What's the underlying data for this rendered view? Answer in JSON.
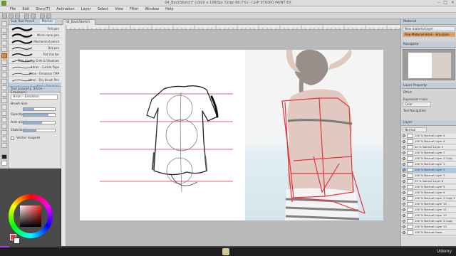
{
  "window": {
    "title": "04_BackSketch* (1920 x 1080px 72dpi 66.7%) - CLIP STUDIO PAINT EX"
  },
  "menu": [
    "File",
    "Edit",
    "Story(T)",
    "Animation",
    "Layer",
    "Select",
    "View",
    "Filter",
    "Window",
    "Help"
  ],
  "subtool_panel": {
    "tab": "Sub Tool Pencil",
    "tab2": "Marker",
    "brushes": [
      "Felt pen",
      "Micro-nano pen",
      "Mechanical pencil",
      "Dot pen",
      "Flat marker",
      "Thin Analog Grits & Shadows",
      "Hiron - Cuticle Tape",
      "Hiron - Emulsion TMP",
      "Hiron - Dry Brush Pen",
      "Hiron - Emulsion"
    ],
    "selected_index": 9
  },
  "tool_detail": {
    "tab": "Tool property [Hiron - Emulsion]",
    "selected_brush": "Hiron - Emulsion",
    "props": [
      {
        "label": "Brush Size",
        "value": 0.35
      },
      {
        "label": "Opacity",
        "value": 0.8
      },
      {
        "label": "Anti-aliasing",
        "value": 0.6
      },
      {
        "label": "Stabilization",
        "value": 0.4
      }
    ],
    "vector_label": "Vector magnet"
  },
  "document_tab": "04_BackSketch",
  "right_panel": {
    "header": "Material",
    "materials": [
      "New material layer",
      "Fine Material Hiron - Emulsion"
    ],
    "navigator_tab": "Navigator",
    "layer_property": "Layer Property",
    "effect_label": "Effect",
    "expression_label": "Expression color",
    "color_label": "Color",
    "tool_nav_label": "Tool Navigation",
    "layers_tab": "Layer",
    "blend_mode": "Normal",
    "layers": [
      "100 % Normal Layer 4",
      "100 % Normal Layer 6",
      "40 % Normal Layer 5",
      "100 % Normal Layer 7",
      "100 % Normal Layer 3 Copy",
      "100 % Normal Layer 1",
      "100 % Normal Layer 2",
      "100 % Normal Layer 3",
      "35 % Normal Layer 8",
      "100 % Normal Layer 5",
      "100 % Normal Layer 9",
      "100 % Normal Layer 3 Copy 2",
      "100 % Normal Layer 10",
      "100 % Normal Layer 11",
      "100 % Normal Layer 12",
      "100 % Normal Layer 4 Copy",
      "100 % Normal Layer 13",
      "100 % Normal Paper"
    ],
    "selected_layer_index": 6
  },
  "video": {
    "progress": 0.02,
    "brand": "Udemy"
  },
  "colors": {
    "selected_layer": "#aacbe8",
    "selected_material": "#e89c50",
    "guide_red": "#e24a5a",
    "progress_accent": "#a435f0"
  }
}
